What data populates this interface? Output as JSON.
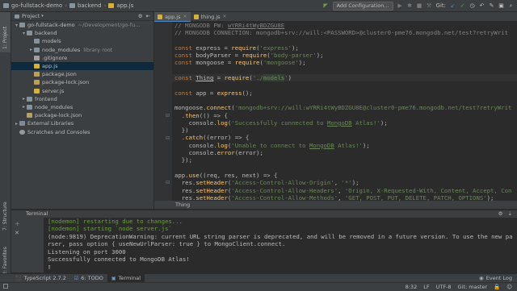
{
  "navbar": {
    "project": "go-fullstack-demo",
    "folder": "backend",
    "file": "app.js",
    "add_configuration": "Add Configuration...",
    "git_label": "Git:"
  },
  "left_strip": {
    "project_tab": "1: Project",
    "structure_tab": "7: Structure",
    "favorites_tab": "2: Favorites"
  },
  "project_panel": {
    "title": "Project",
    "tree": [
      {
        "label": "go-fullstack-demo",
        "hint": "~/Development/go-fu...",
        "depth": 0,
        "arrow": "▾",
        "icon": "folder"
      },
      {
        "label": "backend",
        "hint": "",
        "depth": 1,
        "arrow": "▾",
        "icon": "folder"
      },
      {
        "label": "models",
        "hint": "",
        "depth": 2,
        "arrow": "",
        "icon": "folder"
      },
      {
        "label": "node_modules",
        "hint": "library root",
        "depth": 2,
        "arrow": "▸",
        "icon": "folder"
      },
      {
        "label": ".gitignore",
        "hint": "",
        "depth": 2,
        "arrow": "",
        "icon": "git"
      },
      {
        "label": "app.js",
        "hint": "",
        "depth": 2,
        "arrow": "",
        "icon": "js",
        "selected": true
      },
      {
        "label": "package.json",
        "hint": "",
        "depth": 2,
        "arrow": "",
        "icon": "json"
      },
      {
        "label": "package-lock.json",
        "hint": "",
        "depth": 2,
        "arrow": "",
        "icon": "json"
      },
      {
        "label": "server.js",
        "hint": "",
        "depth": 2,
        "arrow": "",
        "icon": "js"
      },
      {
        "label": "frontend",
        "hint": "",
        "depth": 1,
        "arrow": "▸",
        "icon": "folder"
      },
      {
        "label": "node_modules",
        "hint": "",
        "depth": 1,
        "arrow": "▸",
        "icon": "folder"
      },
      {
        "label": "package-lock.json",
        "hint": "",
        "depth": 1,
        "arrow": "",
        "icon": "json"
      },
      {
        "label": "External Libraries",
        "hint": "",
        "depth": 0,
        "arrow": "▸",
        "icon": "lib"
      },
      {
        "label": "Scratches and Consoles",
        "hint": "",
        "depth": 0,
        "arrow": "",
        "icon": "scratch"
      }
    ]
  },
  "editor": {
    "tabs": [
      {
        "label": "app.js",
        "active": true
      },
      {
        "label": "thing.js",
        "active": false
      }
    ],
    "breadcrumb": "Thing"
  },
  "terminal": {
    "title": "Terminal",
    "lines": [
      {
        "text": "[nodemon] restarting due to changes...",
        "green": true
      },
      {
        "text": "[nodemon] starting `node server.js`",
        "green": true
      },
      {
        "text": "(node:9819) DeprecationWarning: current URL string parser is deprecated, and will be removed in a future version. To use the new pa",
        "green": false
      },
      {
        "text": "rser, pass option { useNewUrlParser: true } to MongoClient.connect.",
        "green": false
      },
      {
        "text": "Listening on port 3000",
        "green": false
      },
      {
        "text": "Successfully connected to MongoDB Atlas!",
        "green": false
      },
      {
        "text": "▯",
        "green": false
      }
    ]
  },
  "bottom_tabs": [
    {
      "label": "TypeScript 2.7.2"
    },
    {
      "label": "6: TODO"
    },
    {
      "label": "Terminal"
    }
  ],
  "event_log": "Event Log",
  "status": {
    "position": "8:32",
    "line_sep": "LF",
    "encoding": "UTF-8",
    "git_branch": "Git: master"
  },
  "colors": {
    "keyword": "#cc7832",
    "string": "#6a8759",
    "comment": "#808080",
    "function": "#ffc66d",
    "nodemon_green": "#6a9e3f"
  }
}
